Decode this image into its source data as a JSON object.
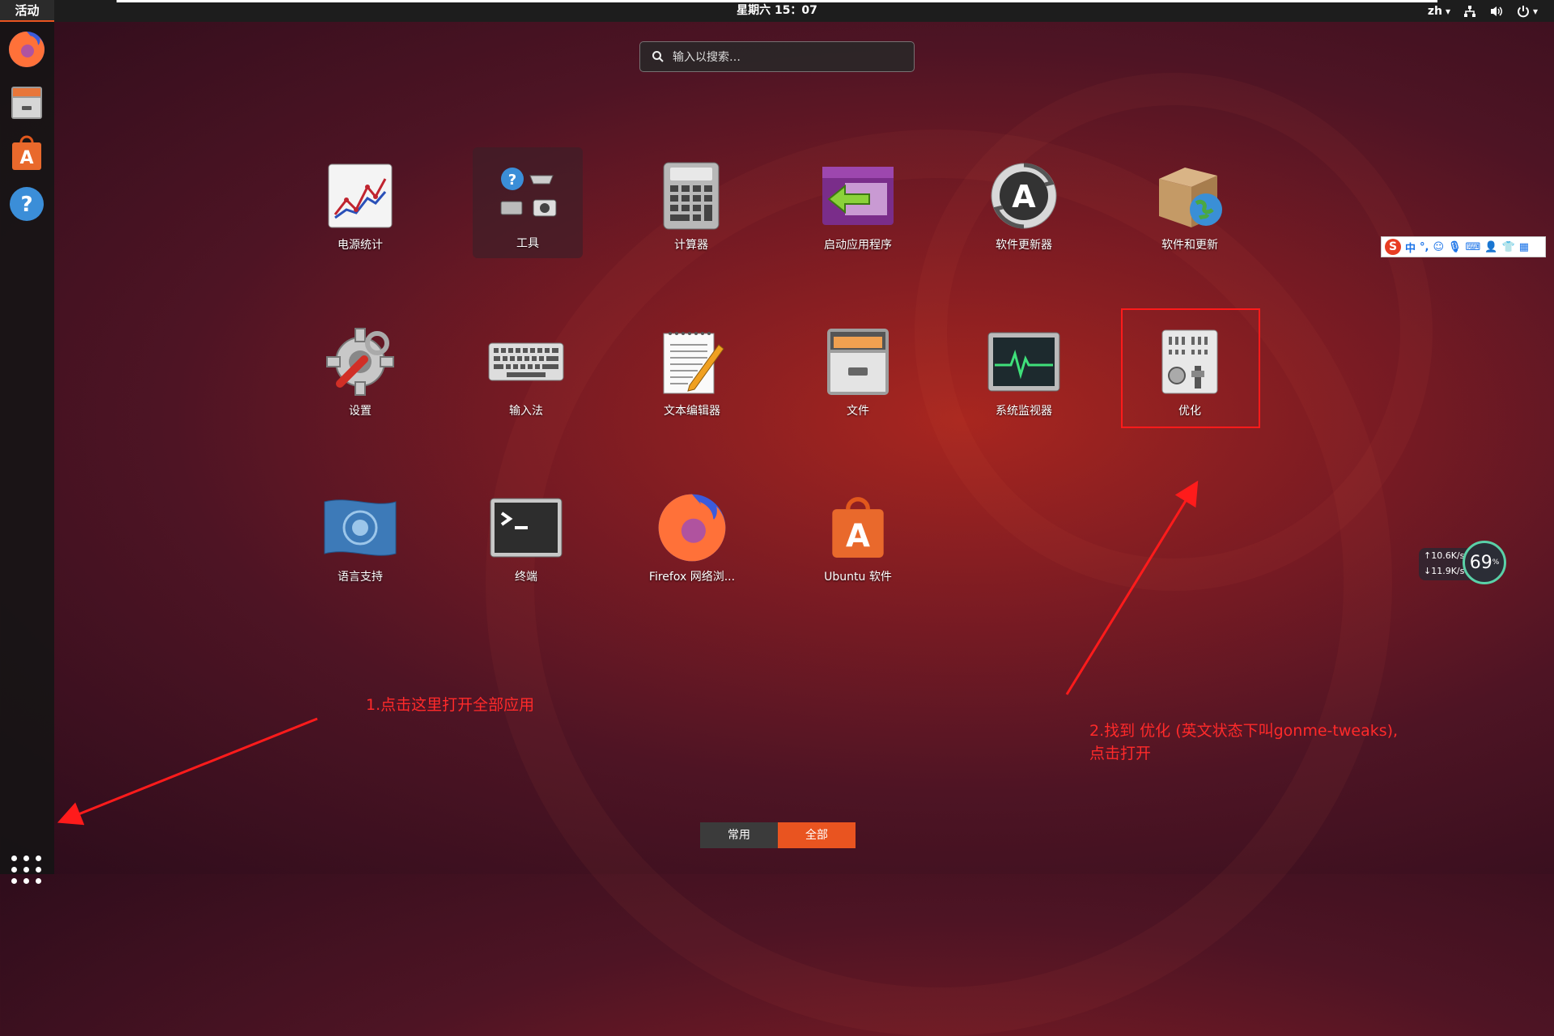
{
  "topbar": {
    "activities": "活动",
    "clock": "星期六 15：07",
    "lang": "zh",
    "lang_arrow": "▾"
  },
  "dock": {
    "items": [
      {
        "name": "firefox"
      },
      {
        "name": "files"
      },
      {
        "name": "ubuntu-software"
      },
      {
        "name": "help"
      }
    ]
  },
  "search": {
    "placeholder": "输入以搜索…"
  },
  "apps": [
    {
      "label": "电源统计"
    },
    {
      "label": "工具"
    },
    {
      "label": "计算器"
    },
    {
      "label": "启动应用程序"
    },
    {
      "label": "软件更新器"
    },
    {
      "label": "软件和更新"
    },
    {
      "label": "设置"
    },
    {
      "label": "输入法"
    },
    {
      "label": "文本编辑器"
    },
    {
      "label": "文件"
    },
    {
      "label": "系统监视器"
    },
    {
      "label": "优化"
    },
    {
      "label": "语言支持"
    },
    {
      "label": "终端"
    },
    {
      "label": "Firefox 网络浏..."
    },
    {
      "label": "Ubuntu 软件"
    }
  ],
  "tabs": {
    "frequent": "常用",
    "all": "全部"
  },
  "annotations": {
    "note1": "1.点击这里打开全部应用",
    "note2_line1": "2.找到 优化 (英文状态下叫gonme-tweaks),",
    "note2_line2": "点击打开",
    "color": "#ff2a2a"
  },
  "ime": {
    "logo": "S",
    "mode": "中"
  },
  "net_widget": {
    "upload": "↑10.6K/s",
    "download": "↓11.9K/s",
    "percent": "69",
    "percent_unit": "%"
  },
  "colors": {
    "accent": "#e95420",
    "annotation": "#ff1b1b"
  }
}
